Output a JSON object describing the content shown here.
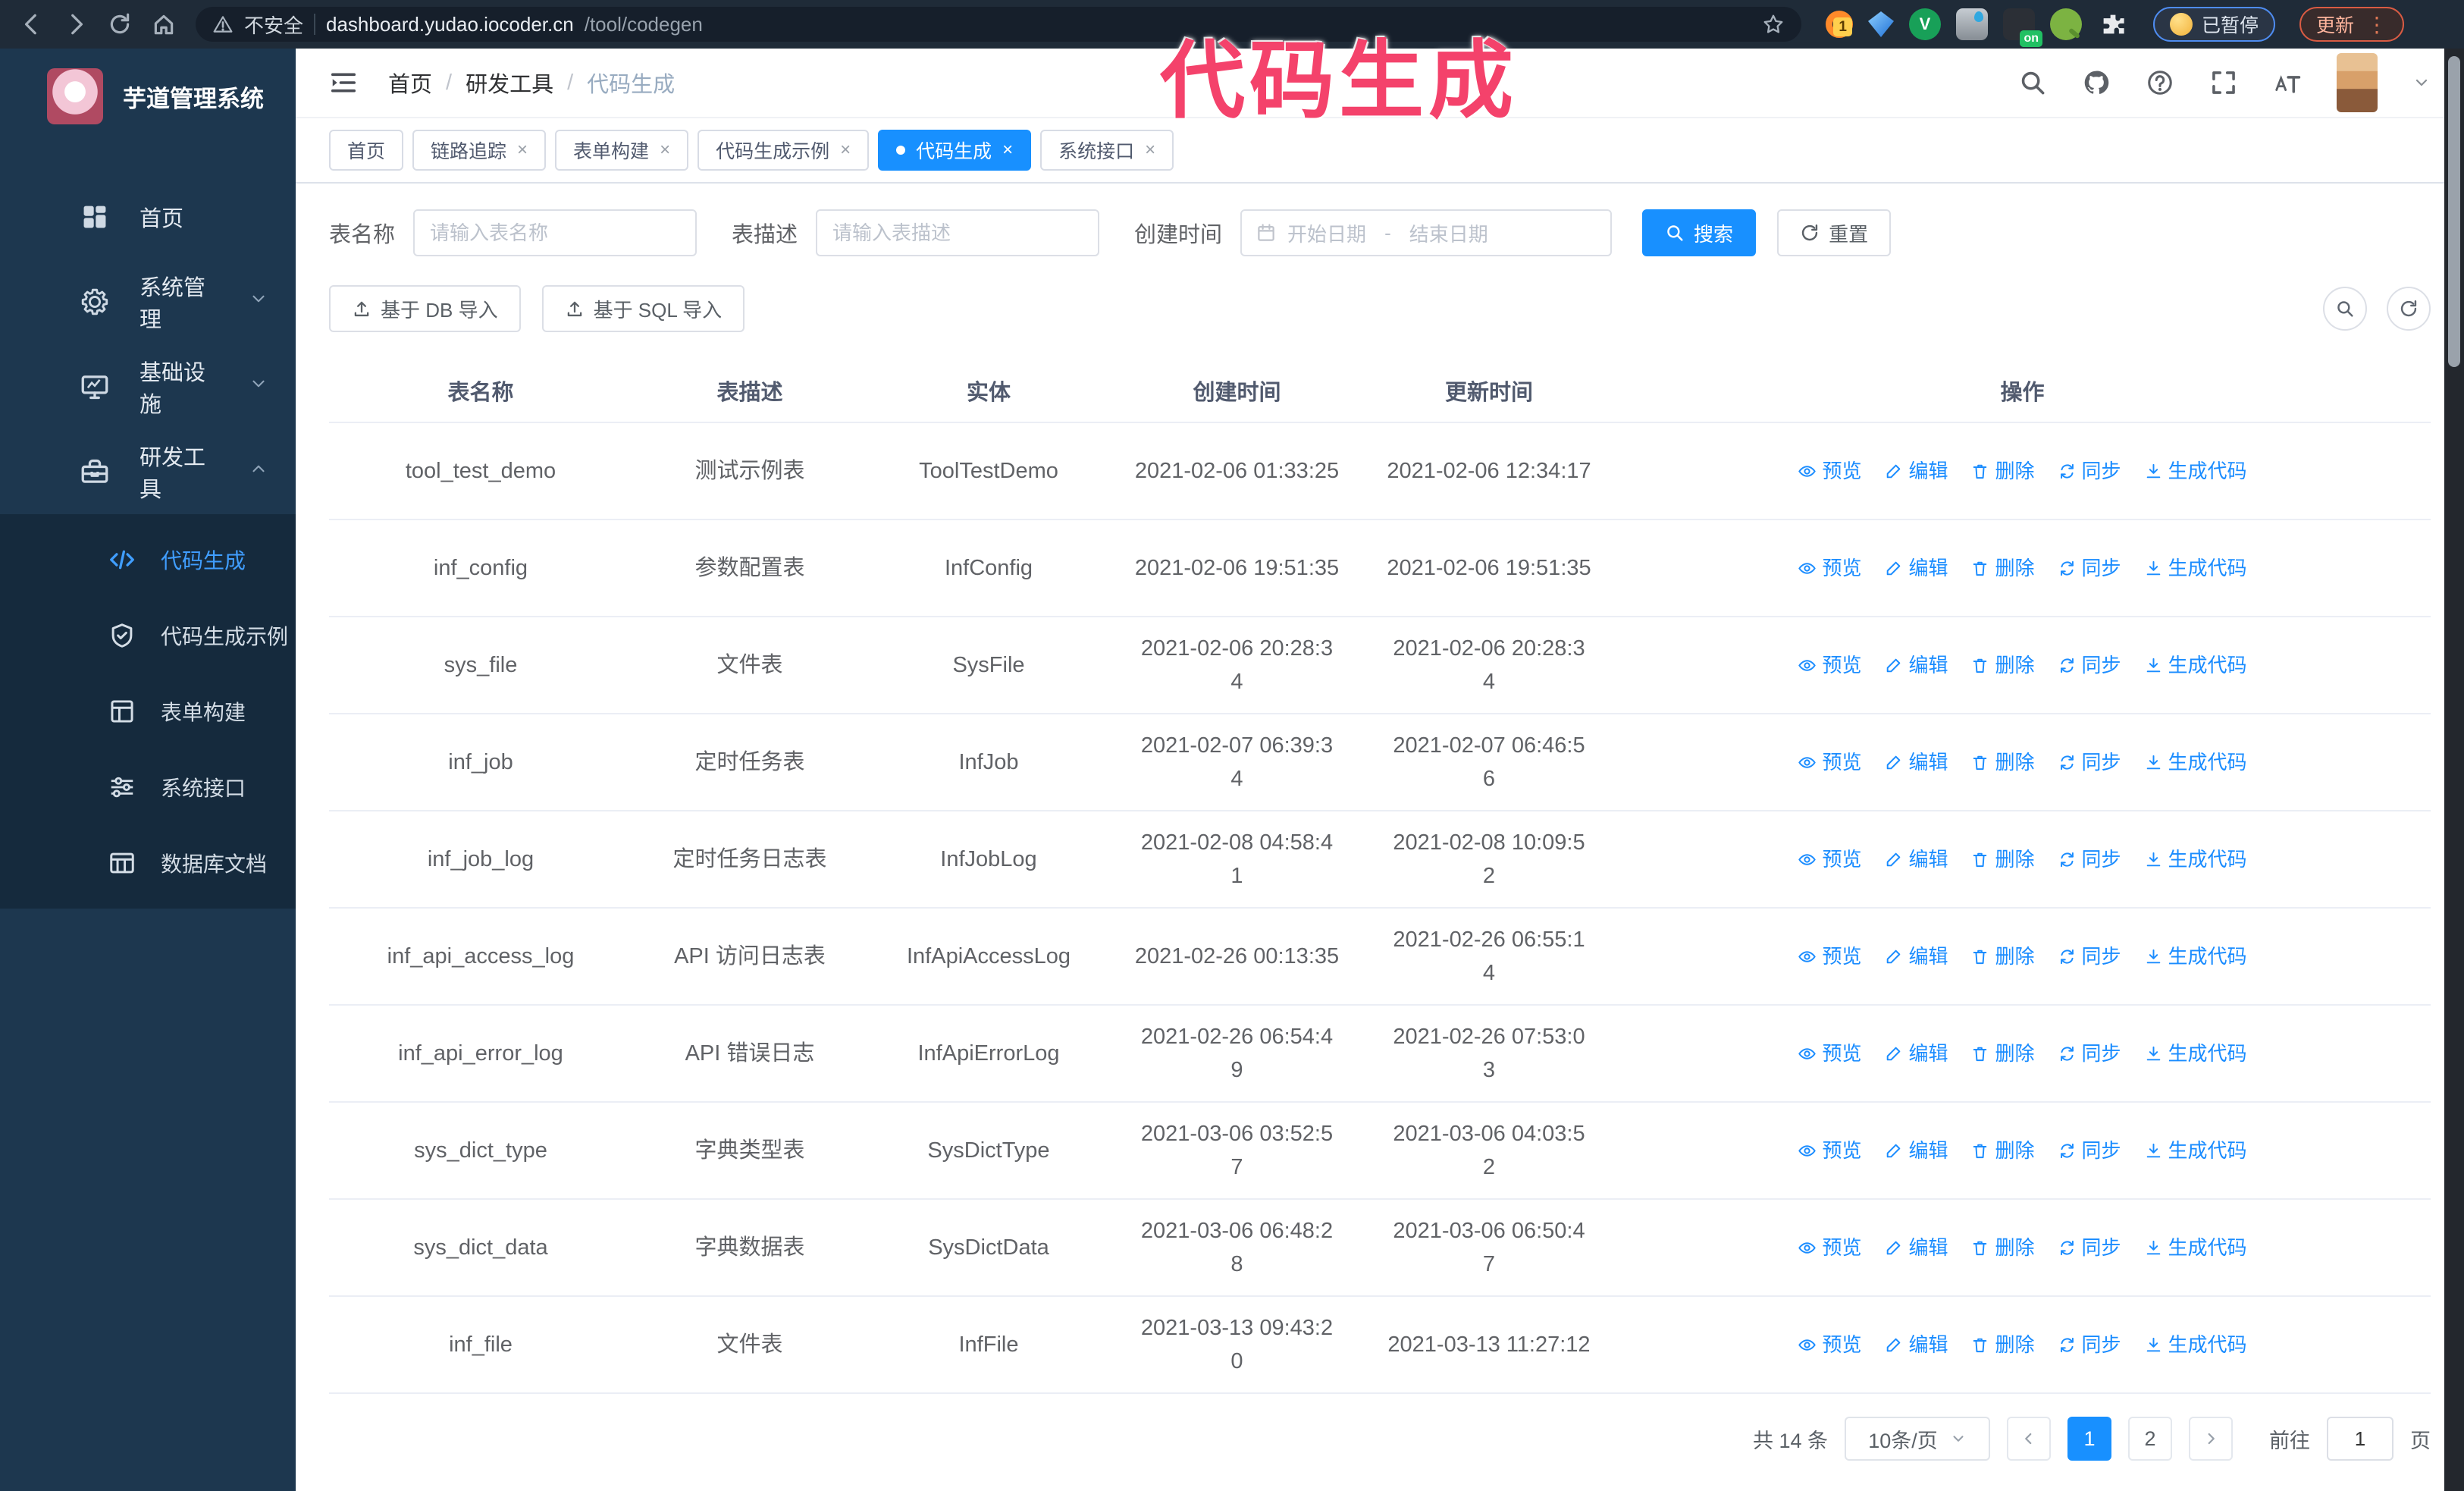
{
  "browser": {
    "url_security": "不安全",
    "url_domain": "dashboard.yudao.iocoder.cn",
    "url_path": "/tool/codegen",
    "paused_badge": "已暂停",
    "update_button": "更新",
    "extension_badge": "1",
    "extension_on_badge": "on",
    "nav_icons": [
      "back",
      "forward",
      "reload",
      "home"
    ],
    "extensions": [
      "orange-ring",
      "blue-gem",
      "green-v",
      "blue-drop",
      "dark-on",
      "green-key",
      "puzzle"
    ]
  },
  "annotation": {
    "text": "代码生成",
    "color": "#f4426b"
  },
  "sidebar": {
    "title": "芋道管理系统",
    "items": [
      {
        "label": "首页",
        "icon": "dashboard",
        "chevron": ""
      },
      {
        "label": "系统管理",
        "icon": "gear",
        "chevron": "down"
      },
      {
        "label": "基础设施",
        "icon": "monitor",
        "chevron": "down"
      },
      {
        "label": "研发工具",
        "icon": "toolbox",
        "chevron": "up"
      }
    ],
    "subitems": [
      {
        "label": "代码生成",
        "icon": "code",
        "active": true
      },
      {
        "label": "代码生成示例",
        "icon": "shield",
        "active": false
      },
      {
        "label": "表单构建",
        "icon": "form",
        "active": false
      },
      {
        "label": "系统接口",
        "icon": "sliders",
        "active": false
      },
      {
        "label": "数据库文档",
        "icon": "dbdoc",
        "active": false
      }
    ]
  },
  "header": {
    "breadcrumb": [
      "首页",
      "研发工具",
      "代码生成"
    ],
    "action_icons": [
      "search",
      "github",
      "help",
      "fullscreen",
      "font-size",
      "caret-down"
    ]
  },
  "tabs": [
    {
      "label": "首页",
      "closable": false,
      "active": false
    },
    {
      "label": "链路追踪",
      "closable": true,
      "active": false
    },
    {
      "label": "表单构建",
      "closable": true,
      "active": false
    },
    {
      "label": "代码生成示例",
      "closable": true,
      "active": false
    },
    {
      "label": "代码生成",
      "closable": true,
      "active": true
    },
    {
      "label": "系统接口",
      "closable": true,
      "active": false
    }
  ],
  "filters": {
    "name_label": "表名称",
    "name_placeholder": "请输入表名称",
    "desc_label": "表描述",
    "desc_placeholder": "请输入表描述",
    "time_label": "创建时间",
    "start_placeholder": "开始日期",
    "range_separator": "-",
    "end_placeholder": "结束日期",
    "search_label": "搜索",
    "reset_label": "重置"
  },
  "toolbar": {
    "import_db": "基于 DB 导入",
    "import_sql": "基于 SQL 导入"
  },
  "table": {
    "columns": [
      "表名称",
      "表描述",
      "实体",
      "创建时间",
      "更新时间",
      "操作"
    ],
    "actions": [
      "预览",
      "编辑",
      "删除",
      "同步",
      "生成代码"
    ],
    "action_icons": [
      "eye",
      "edit",
      "trash",
      "sync",
      "download"
    ],
    "rows": [
      {
        "name": "tool_test_demo",
        "desc": "测试示例表",
        "entity": "ToolTestDemo",
        "created": "2021-02-06 01:33:25",
        "updated": "2021-02-06 12:34:17"
      },
      {
        "name": "inf_config",
        "desc": "参数配置表",
        "entity": "InfConfig",
        "created": "2021-02-06 19:51:35",
        "updated": "2021-02-06 19:51:35"
      },
      {
        "name": "sys_file",
        "desc": "文件表",
        "entity": "SysFile",
        "created": "2021-02-06 20:28:3\n4",
        "updated": "2021-02-06 20:28:3\n4"
      },
      {
        "name": "inf_job",
        "desc": "定时任务表",
        "entity": "InfJob",
        "created": "2021-02-07 06:39:3\n4",
        "updated": "2021-02-07 06:46:5\n6"
      },
      {
        "name": "inf_job_log",
        "desc": "定时任务日志表",
        "entity": "InfJobLog",
        "created": "2021-02-08 04:58:4\n1",
        "updated": "2021-02-08 10:09:5\n2"
      },
      {
        "name": "inf_api_access_log",
        "desc": "API 访问日志表",
        "entity": "InfApiAccessLog",
        "created": "2021-02-26 00:13:35",
        "updated": "2021-02-26 06:55:1\n4"
      },
      {
        "name": "inf_api_error_log",
        "desc": "API 错误日志",
        "entity": "InfApiErrorLog",
        "created": "2021-02-26 06:54:4\n9",
        "updated": "2021-02-26 07:53:0\n3"
      },
      {
        "name": "sys_dict_type",
        "desc": "字典类型表",
        "entity": "SysDictType",
        "created": "2021-03-06 03:52:5\n7",
        "updated": "2021-03-06 04:03:5\n2"
      },
      {
        "name": "sys_dict_data",
        "desc": "字典数据表",
        "entity": "SysDictData",
        "created": "2021-03-06 06:48:2\n8",
        "updated": "2021-03-06 06:50:4\n7"
      },
      {
        "name": "inf_file",
        "desc": "文件表",
        "entity": "InfFile",
        "created": "2021-03-13 09:43:2\n0",
        "updated": "2021-03-13 11:27:12"
      }
    ]
  },
  "pagination": {
    "total": "共 14 条",
    "page_size": "10条/页",
    "pages": [
      "1",
      "2"
    ],
    "active_page": "1",
    "goto_label": "前往",
    "goto_value": "1",
    "page_label": "页"
  }
}
